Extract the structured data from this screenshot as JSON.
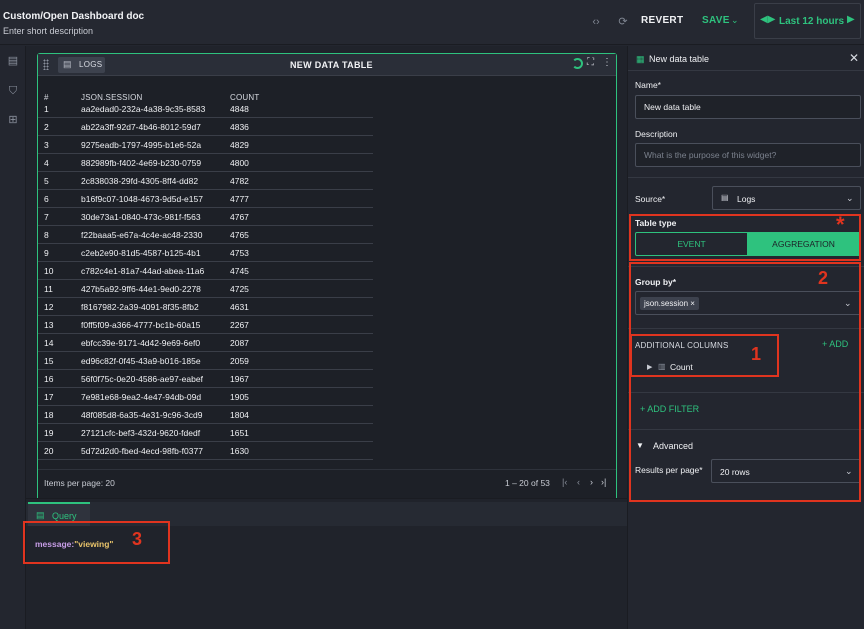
{
  "header": {
    "title": "Custom/Open Dashboard doc",
    "description": "Enter short description",
    "revert_label": "REVERT",
    "save_label": "SAVE",
    "time_range_label": "Last 12 hours"
  },
  "widget": {
    "tab_label": "LOGS",
    "title": "NEW DATA TABLE",
    "columns": [
      "#",
      "JSON.SESSION",
      "COUNT"
    ],
    "rows": [
      {
        "n": "1",
        "session": "aa2edad0-232a-4a38-9c35-8583",
        "count": "4848"
      },
      {
        "n": "2",
        "session": "ab22a3ff-92d7-4b46-8012-59d7",
        "count": "4836"
      },
      {
        "n": "3",
        "session": "9275eadb-1797-4995-b1e6-52a",
        "count": "4829"
      },
      {
        "n": "4",
        "session": "882989fb-f402-4e69-b230-0759",
        "count": "4800"
      },
      {
        "n": "5",
        "session": "2c838038-29fd-4305-8ff4-dd82",
        "count": "4782"
      },
      {
        "n": "6",
        "session": "b16f9c07-1048-4673-9d5d-e157",
        "count": "4777"
      },
      {
        "n": "7",
        "session": "30de73a1-0840-473c-981f-f563",
        "count": "4767"
      },
      {
        "n": "8",
        "session": "f22baaa5-e67a-4c4e-ac48-2330",
        "count": "4765"
      },
      {
        "n": "9",
        "session": "c2eb2e90-81d5-4587-b125-4b1",
        "count": "4753"
      },
      {
        "n": "10",
        "session": "c782c4e1-81a7-44ad-abea-11a6",
        "count": "4745"
      },
      {
        "n": "11",
        "session": "427b5a92-9ff6-44e1-9ed0-2278",
        "count": "4725"
      },
      {
        "n": "12",
        "session": "f8167982-2a39-4091-8f35-8fb2",
        "count": "4631"
      },
      {
        "n": "13",
        "session": "f0ff5f09-a366-4777-bc1b-60a15",
        "count": "2267"
      },
      {
        "n": "14",
        "session": "ebfcc39e-9171-4d42-9e69-6ef0",
        "count": "2087"
      },
      {
        "n": "15",
        "session": "ed96c82f-0f45-43a9-b016-185e",
        "count": "2059"
      },
      {
        "n": "16",
        "session": "56f0f75c-0e20-4586-ae97-eabef",
        "count": "1967"
      },
      {
        "n": "17",
        "session": "7e981e68-9ea2-4e47-94db-09d",
        "count": "1905"
      },
      {
        "n": "18",
        "session": "48f085d8-6a35-4e31-9c96-3cd9",
        "count": "1804"
      },
      {
        "n": "19",
        "session": "27121cfc-bef3-432d-9620-fdedf",
        "count": "1651"
      },
      {
        "n": "20",
        "session": "5d72d2d0-fbed-4ecd-98fb-f0377",
        "count": "1630"
      }
    ],
    "items_per_page_label": "Items per page: 20",
    "range_label": "1 – 20 of 53"
  },
  "query": {
    "tab_label": "Query",
    "key": "message:",
    "value": "\"viewing\""
  },
  "panel": {
    "title": "New data table",
    "name_label": "Name*",
    "name_value": "New data table",
    "description_label": "Description",
    "description_placeholder": "What is the purpose of this widget?",
    "source_label": "Source*",
    "source_value": "Logs",
    "table_type_label": "Table type",
    "table_type_event": "EVENT",
    "table_type_aggregation": "AGGREGATION",
    "group_by_label": "Group by*",
    "group_by_chip": "json.session ×",
    "additional_columns_label": "ADDITIONAL COLUMNS",
    "add_label": "+ ADD",
    "count_label": "Count",
    "add_filter_label": "+ ADD FILTER",
    "advanced_label": "Advanced",
    "results_per_page_label": "Results per page*",
    "results_per_page_value": "20 rows"
  },
  "annotations": {
    "star": "*",
    "one": "1",
    "two": "2",
    "three": "3"
  },
  "colors": {
    "accent": "#2ec27e",
    "annotation": "#e0341f"
  }
}
